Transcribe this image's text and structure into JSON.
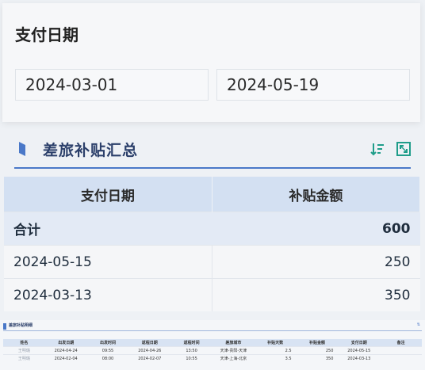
{
  "filter": {
    "title": "支付日期",
    "start_date": "2024-03-01",
    "end_date": "2024-05-19"
  },
  "summary": {
    "title": "差旅补贴汇总",
    "headers": [
      "支付日期",
      "补贴金额"
    ],
    "total": {
      "label": "合计",
      "amount": "600"
    },
    "rows": [
      {
        "date": "2024-05-15",
        "amount": "250"
      },
      {
        "date": "2024-03-13",
        "amount": "350"
      }
    ],
    "accent_color": "#4a78c8",
    "header_bg": "#d3e0f2"
  },
  "detail": {
    "title": "差旅补贴明细",
    "headers": [
      "姓名",
      "出发日期",
      "出发时间",
      "返程日期",
      "返程时间",
      "差旅城市",
      "补贴天数",
      "补贴金额",
      "支付日期",
      "备注"
    ],
    "rows": [
      [
        "王明璐",
        "2024-04-24",
        "09:55",
        "2024-04-26",
        "13:50",
        "天津-贵阳-天津",
        "2.5",
        "250",
        "2024-05-15",
        ""
      ],
      [
        "王明璐",
        "2024-02-04",
        "08:00",
        "2024-02-07",
        "10:55",
        "天津-上海-北京",
        "3.5",
        "350",
        "2024-03-13",
        ""
      ]
    ]
  }
}
